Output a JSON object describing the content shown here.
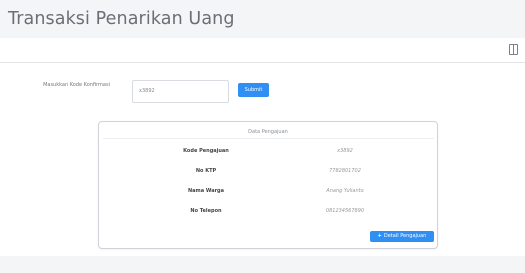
{
  "header": {
    "title": "Transaksi Penarikan Uang"
  },
  "toolbar": {
    "expand_icon": "sidebar-toggle-icon"
  },
  "form": {
    "label": "Masukkan Kode Konfirmasi",
    "input_value": "x3892",
    "submit_label": "Submit"
  },
  "card": {
    "title": "Data Pengajuan",
    "rows": [
      {
        "label": "Kode Pengajuan",
        "value": "x3892"
      },
      {
        "label": "No KTP",
        "value": "7782801702"
      },
      {
        "label": "Nama Warga",
        "value": "Anang Yulianto"
      },
      {
        "label": "No Telepon",
        "value": "081234567890"
      }
    ],
    "detail_label": "Detail Pengajuan"
  },
  "colors": {
    "accent": "#2f8ff2",
    "header_bg": "#f4f5f7"
  }
}
